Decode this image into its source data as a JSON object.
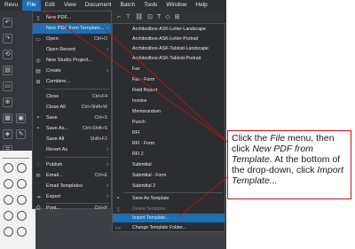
{
  "menubar": {
    "items": [
      "Revu",
      "File",
      "Edit",
      "View",
      "Document",
      "Batch",
      "Tools",
      "Window",
      "Help"
    ],
    "active": "File"
  },
  "file_menu": {
    "items": [
      {
        "label": "New PDF...",
        "shortcut": "",
        "submenu": false,
        "icon": "new-pdf-icon"
      },
      {
        "label": "New PDF from Template...",
        "shortcut": "",
        "submenu": true,
        "icon": "",
        "highlighted": true
      },
      {
        "label": "Open",
        "shortcut": "Ctrl+O",
        "submenu": false,
        "icon": "open-folder-icon"
      },
      {
        "label": "Open Recent",
        "shortcut": "",
        "submenu": true,
        "icon": ""
      },
      {
        "label": "New Studio Project...",
        "shortcut": "",
        "submenu": false,
        "icon": "studio-project-icon"
      },
      {
        "label": "Create",
        "shortcut": "",
        "submenu": true,
        "icon": "create-icon"
      },
      {
        "label": "Combine...",
        "shortcut": "",
        "submenu": false,
        "icon": "combine-icon"
      },
      {
        "label": "Close",
        "shortcut": "Ctrl+F4",
        "submenu": false,
        "icon": ""
      },
      {
        "label": "Close All",
        "shortcut": "Ctrl+Shift+W",
        "submenu": false,
        "icon": ""
      },
      {
        "label": "Save",
        "shortcut": "Ctrl+S",
        "submenu": false,
        "icon": "save-icon"
      },
      {
        "label": "Save As...",
        "shortcut": "Ctrl+Shift+S",
        "submenu": false,
        "icon": "save-as-icon"
      },
      {
        "label": "Save All",
        "shortcut": "Shift+F2",
        "submenu": false,
        "icon": ""
      },
      {
        "label": "Revert As",
        "shortcut": "",
        "submenu": true,
        "icon": ""
      },
      {
        "label": "Publish",
        "shortcut": "",
        "submenu": true,
        "icon": "publish-icon"
      },
      {
        "label": "Email...",
        "shortcut": "Ctrl+E",
        "submenu": false,
        "icon": "email-icon"
      },
      {
        "label": "Email Templates",
        "shortcut": "",
        "submenu": true,
        "icon": ""
      },
      {
        "label": "Export",
        "shortcut": "",
        "submenu": true,
        "icon": "export-icon"
      },
      {
        "label": "Print...",
        "shortcut": "Ctrl+P",
        "submenu": false,
        "icon": "print-icon"
      }
    ]
  },
  "template_menu": {
    "items": [
      {
        "label": "Architoolbox-ASK-Letter-Landscape",
        "icon": ""
      },
      {
        "label": "Architoolbox-ASK-Letter-Portrait",
        "icon": ""
      },
      {
        "label": "Architoolbox-ASK-Tabloid-Landscape",
        "icon": ""
      },
      {
        "label": "Architoolbox-ASK-Tabloid-Portrait",
        "icon": ""
      },
      {
        "label": "Fax",
        "icon": ""
      },
      {
        "label": "Fax - Form",
        "icon": ""
      },
      {
        "label": "Field Report",
        "icon": ""
      },
      {
        "label": "Invoice",
        "icon": ""
      },
      {
        "label": "Memorandum",
        "icon": ""
      },
      {
        "label": "Punch",
        "icon": ""
      },
      {
        "label": "RFI",
        "icon": ""
      },
      {
        "label": "RFI - Form",
        "icon": ""
      },
      {
        "label": "RFI 2",
        "icon": ""
      },
      {
        "label": "Submittal",
        "icon": ""
      },
      {
        "label": "Submittal - Form",
        "icon": ""
      },
      {
        "label": "Submittal 2",
        "icon": ""
      },
      {
        "label": "Save As Template",
        "icon": "save-template-icon"
      },
      {
        "label": "Delete Template",
        "icon": "delete-template-icon",
        "disabled": true
      },
      {
        "label": "Import Template...",
        "icon": "",
        "highlighted": true
      },
      {
        "label": "Change Template Folder...",
        "icon": "folder-icon"
      }
    ]
  },
  "callout": {
    "p1": "Click the ",
    "p2": "File",
    "p3": " menu, then click ",
    "p4": "New PDF from Template.",
    "p5": "  At the bottom of the drop-down, click ",
    "p6": "Import Template..."
  },
  "colors": {
    "highlight": "#1f6fb0",
    "menu_bg": "#2b2d31",
    "callout_border": "#c41212"
  }
}
